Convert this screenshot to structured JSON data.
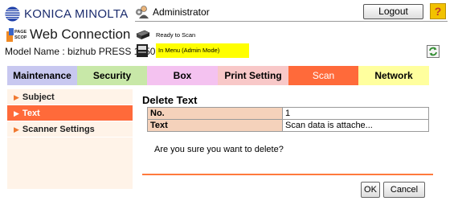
{
  "header": {
    "brand": "KONICA MINOLTA",
    "product_badge": "PAGE SCOPE",
    "product": "Web Connection",
    "model": "Model Name : bizhub PRESS 1250",
    "user": "Administrator",
    "logout_label": "Logout",
    "help_label": "?",
    "status_ready": "Ready to Scan",
    "status_mode": "In Menu (Admin Mode)",
    "colors": {
      "brand_blue": "#1a2b6d",
      "mode_highlight": "#ffff00",
      "help": "#f2c200"
    }
  },
  "tabs": [
    {
      "label": "Maintenance",
      "color": "#c8c8f0"
    },
    {
      "label": "Security",
      "color": "#c8e8a8"
    },
    {
      "label": "Box",
      "color": "#f4c2f0"
    },
    {
      "label": "Print Setting",
      "color": "#f8c8c8"
    },
    {
      "label": "Scan",
      "color": "#ff6a3a",
      "active": true
    },
    {
      "label": "Network",
      "color": "#ffff9e"
    }
  ],
  "sidebar": {
    "items": [
      {
        "label": "Subject",
        "icon": "triangle-right-icon"
      },
      {
        "label": "Text",
        "icon": "triangle-right-icon",
        "active": true
      },
      {
        "label": "Scanner Settings",
        "icon": "triangle-right-icon"
      }
    ]
  },
  "main": {
    "title": "Delete Text",
    "rows": [
      {
        "key": "No.",
        "value": "1"
      },
      {
        "key": "Text",
        "value": "Scan data is attache..."
      }
    ],
    "confirm_message": "Are you sure you want to delete?",
    "ok_label": "OK",
    "cancel_label": "Cancel",
    "accent": "#ff7a3d"
  }
}
